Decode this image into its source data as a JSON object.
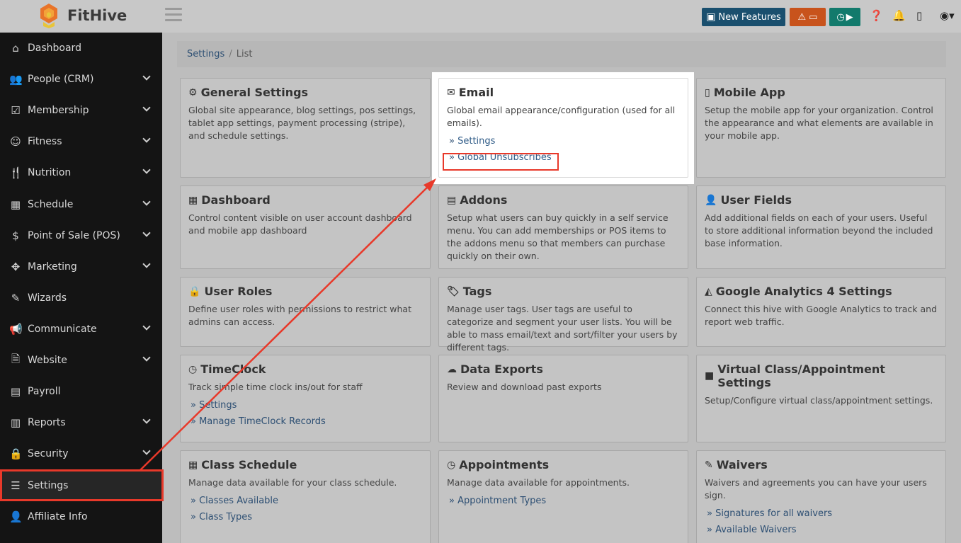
{
  "app": {
    "name": "FitHive"
  },
  "topbar": {
    "new_features_label": "New Features"
  },
  "sidebar": {
    "items": [
      {
        "label": "Dashboard",
        "icon": "home-icon",
        "glyph": "⌂",
        "chevron": false
      },
      {
        "label": "People (CRM)",
        "icon": "users-icon",
        "glyph": "👥",
        "chevron": true
      },
      {
        "label": "Membership",
        "icon": "checkbox-icon",
        "glyph": "☑",
        "chevron": true
      },
      {
        "label": "Fitness",
        "icon": "figure-icon",
        "glyph": "☺",
        "chevron": true
      },
      {
        "label": "Nutrition",
        "icon": "utensils-icon",
        "glyph": "🍴",
        "chevron": true
      },
      {
        "label": "Schedule",
        "icon": "calendar-icon",
        "glyph": "▦",
        "chevron": true
      },
      {
        "label": "Point of Sale (POS)",
        "icon": "dollar-icon",
        "glyph": "$",
        "chevron": true
      },
      {
        "label": "Marketing",
        "icon": "crosshair-icon",
        "glyph": "✥",
        "chevron": true
      },
      {
        "label": "Wizards",
        "icon": "wand-icon",
        "glyph": "✎",
        "chevron": false
      },
      {
        "label": "Communicate",
        "icon": "megaphone-icon",
        "glyph": "📢",
        "chevron": true
      },
      {
        "label": "Website",
        "icon": "file-icon",
        "glyph": "🗎",
        "chevron": true
      },
      {
        "label": "Payroll",
        "icon": "money-icon",
        "glyph": "▤",
        "chevron": false
      },
      {
        "label": "Reports",
        "icon": "bar-chart-icon",
        "glyph": "▥",
        "chevron": true
      },
      {
        "label": "Security",
        "icon": "lock-icon",
        "glyph": "🔒",
        "chevron": true
      },
      {
        "label": "Settings",
        "icon": "sliders-icon",
        "glyph": "☰",
        "chevron": false,
        "active": true
      },
      {
        "label": "Affiliate Info",
        "icon": "user-plus-icon",
        "glyph": "👤",
        "chevron": false
      }
    ]
  },
  "breadcrumb": {
    "root": "Settings",
    "separator": "/",
    "current": "List"
  },
  "cards": {
    "general": {
      "title": "General Settings",
      "desc": "Global site appearance, blog settings, pos settings, tablet app settings, payment processing (stripe), and schedule settings."
    },
    "email": {
      "title": "Email",
      "desc": "Global email appearance/configuration (used for all emails).",
      "links": [
        "Settings",
        "Global Unsubscribes"
      ]
    },
    "mobile": {
      "title": "Mobile App",
      "desc": "Setup the mobile app for your organization. Control the appearance and what elements are available in your mobile app."
    },
    "dashboard": {
      "title": "Dashboard",
      "desc": "Control content visible on user account dashboard and mobile app dashboard"
    },
    "addons": {
      "title": "Addons",
      "desc": "Setup what users can buy quickly in a self service menu. You can add memberships or POS items to the addons menu so that members can purchase quickly on their own."
    },
    "userfields": {
      "title": "User Fields",
      "desc": "Add additional fields on each of your users. Useful to store additional information beyond the included base information."
    },
    "roles": {
      "title": "User Roles",
      "desc": "Define user roles with permissions to restrict what admins can access."
    },
    "tags": {
      "title": "Tags",
      "desc": "Manage user tags. User tags are useful to categorize and segment your user lists. You will be able to mass email/text and sort/filter your users by different tags."
    },
    "ga4": {
      "title": "Google Analytics 4 Settings",
      "desc": "Connect this hive with Google Analytics to track and report web traffic."
    },
    "timeclock": {
      "title": "TimeClock",
      "desc": "Track simple time clock ins/out for staff",
      "links": [
        "Settings",
        "Manage TimeClock Records"
      ]
    },
    "exports": {
      "title": "Data Exports",
      "desc": "Review and download past exports"
    },
    "virtual": {
      "title": "Virtual Class/Appointment Settings",
      "desc": "Setup/Configure virtual class/appointment settings."
    },
    "classschedule": {
      "title": "Class Schedule",
      "desc": "Manage data available for your class schedule.",
      "links": [
        "Classes Available",
        "Class Types"
      ]
    },
    "appointments": {
      "title": "Appointments",
      "desc": "Manage data available for appointments.",
      "links": [
        "Appointment Types"
      ]
    },
    "waivers": {
      "title": "Waivers",
      "desc": "Waivers and agreements you can have your users sign.",
      "links": [
        "Signatures for all waivers",
        "Available Waivers"
      ]
    }
  },
  "colors": {
    "sidebar_bg": "#141414",
    "highlight": "#e8392a",
    "link": "#2d4f73",
    "new_features_bg": "#1a4f6e",
    "warn_bg": "#c8531c",
    "clock_bg": "#127a6c"
  }
}
